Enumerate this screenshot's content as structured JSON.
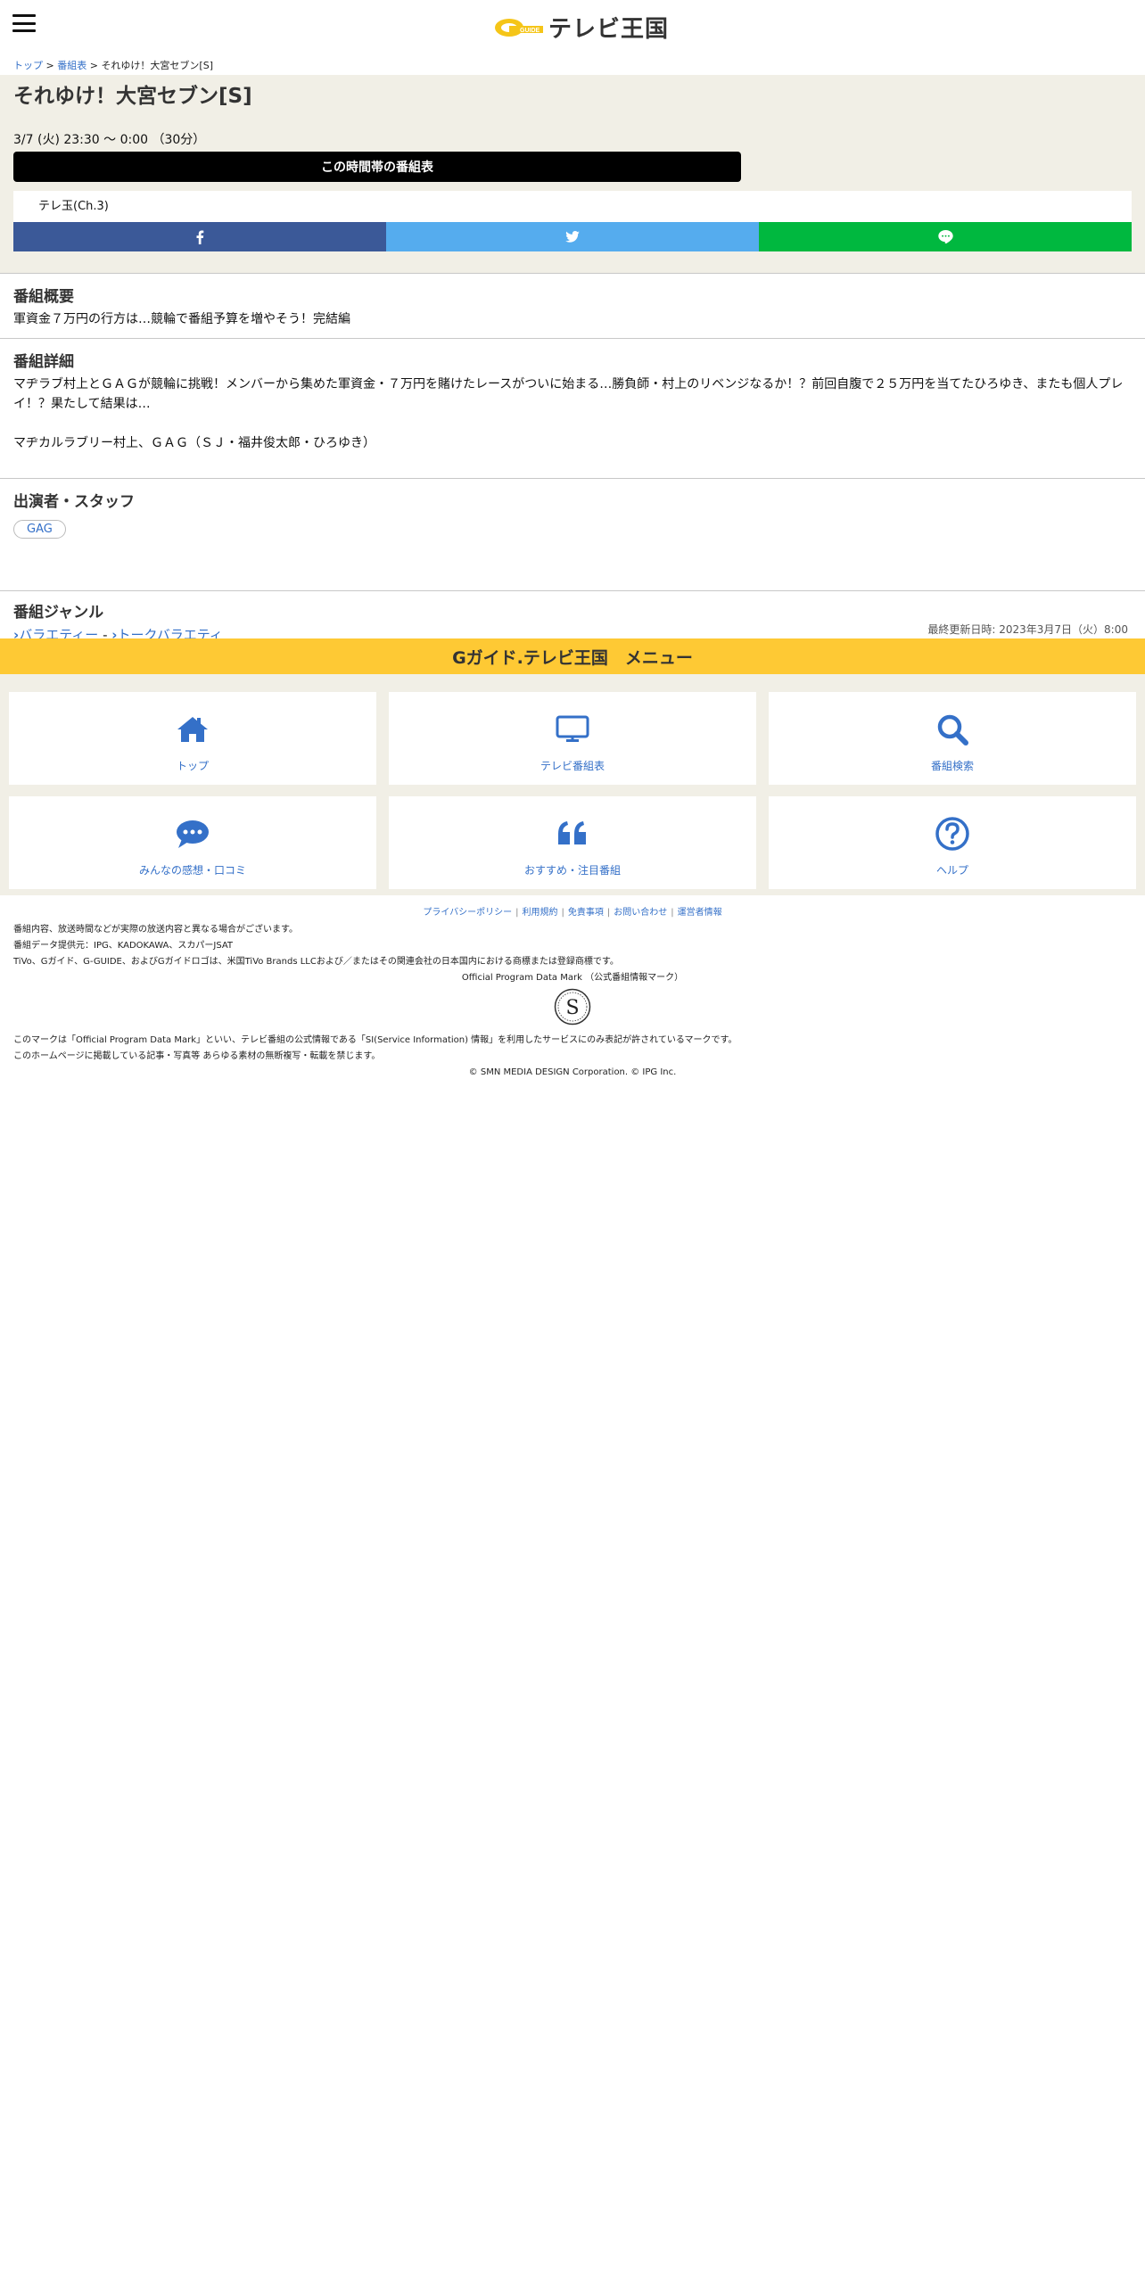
{
  "header": {
    "logo_text": "テレビ王国"
  },
  "breadcrumb": {
    "top": "トップ",
    "sep1": " > ",
    "schedule": "番組表",
    "sep2": " > ",
    "current": "それゆけ！大宮セブン[S]"
  },
  "program": {
    "title": "それゆけ！大宮セブン[S]",
    "airtime": "3/7 (火) 23:30 ～ 0:00 （30分）",
    "timeslot_button": "この時間帯の番組表",
    "channel": "テレ玉(Ch.3)"
  },
  "share": {
    "facebook_icon": "f",
    "twitter_icon": "🐦",
    "line_icon": "LINE"
  },
  "overview": {
    "heading": "番組概要",
    "text": "軍資金７万円の行方は…競輪で番組予算を増やそう！完結編"
  },
  "detail": {
    "heading": "番組詳細",
    "text1": "マヂラブ村上とＧＡＧが競輪に挑戦！メンバーから集めた軍資金・７万円を賭けたレースがついに始まる…勝負師・村上のリベンジなるか！？前回自腹で２５万円を当てたひろゆき、またも個人プレイ！？果たして結果は…",
    "text2": "マヂカルラブリー村上、ＧＡＧ（ＳＪ・福井俊太郎・ひろゆき）"
  },
  "cast": {
    "heading": "出演者・スタッフ",
    "tags": [
      "GAG"
    ]
  },
  "genre": {
    "heading": "番組ジャンル",
    "chev": "›",
    "primary": "バラエティー",
    "sep": " - ",
    "secondary": "トークバラエティ"
  },
  "updated": "最終更新日時: 2023年3月7日（火）8:00",
  "menu": {
    "title": "Gガイド.テレビ王国　メニュー",
    "items": [
      {
        "label": "トップ",
        "icon": "home-icon"
      },
      {
        "label": "テレビ番組表",
        "icon": "tv-icon"
      },
      {
        "label": "番組検索",
        "icon": "search-icon"
      },
      {
        "label": "みんなの感想・口コミ",
        "icon": "comment-icon"
      },
      {
        "label": "おすすめ・注目番組",
        "icon": "quote-icon"
      },
      {
        "label": "ヘルプ",
        "icon": "help-icon"
      }
    ]
  },
  "footer": {
    "links": [
      "プライバシーポリシー",
      "利用規約",
      "免責事項",
      "お問い合わせ",
      "運営者情報"
    ],
    "sep": "|",
    "line1": "番組内容、放送時間などが実際の放送内容と異なる場合がございます。",
    "line2": "番組データ提供元：IPG、KADOKAWA、スカパーJSAT",
    "line3": "TiVo、Gガイド、G-GUIDE、およびGガイドロゴは、米国TiVo Brands LLCおよび／またはその関連会社の日本国内における商標または登録商標です。",
    "mark_label": "Official Program Data Mark （公式番組情報マーク）",
    "mark_letter": "S",
    "line4": "このマークは「Official Program Data Mark」といい、テレビ番組の公式情報である「SI(Service Information) 情報」を利用したサービスにのみ表記が許されているマークです。",
    "line5": "このホームページに掲載している記事・写真等 あらゆる素材の無断複写・転載を禁じます。",
    "copyright": "© SMN MEDIA DESIGN Corporation. © IPG Inc."
  },
  "colors": {
    "accent_blue": "#3470c8",
    "menu_yellow": "#fec934",
    "facebook": "#3b5998",
    "twitter": "#55acee",
    "line": "#00b83f",
    "beige": "#f1efe6"
  }
}
